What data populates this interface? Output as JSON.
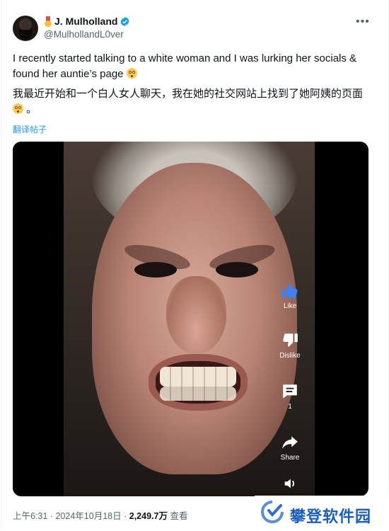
{
  "author": {
    "name": "J. Mulholland",
    "handle": "@MulhollandL0ver"
  },
  "tweet": {
    "text_en": "I recently started talking to a white woman and I was lurking her socials & found her auntie’s page",
    "text_zh": "我最近开始和一个白人女人聊天，我在她的社交网站上找到了她阿姨的页面",
    "text_zh_end": "。",
    "translate_label": "翻译帖子"
  },
  "video_overlay": {
    "like_label": "Like",
    "dislike_label": "Dislike",
    "comment_count": "1",
    "share_label": "Share"
  },
  "meta": {
    "time": "上午6:31",
    "separator": "·",
    "date": "2024年10月18日",
    "views": "2,249.7万",
    "views_label": "查看"
  },
  "watermark": {
    "text": "攀登软件园"
  },
  "colors": {
    "accent": "#1d9bf0",
    "muted": "#536471",
    "watermark": "#1b5ebd"
  },
  "icons": [
    "medal-icon",
    "verified-badge-icon",
    "more-icon",
    "flushed-emoji-icon",
    "thumbs-up-icon",
    "thumbs-down-icon",
    "comment-icon",
    "share-icon",
    "sound-icon"
  ]
}
